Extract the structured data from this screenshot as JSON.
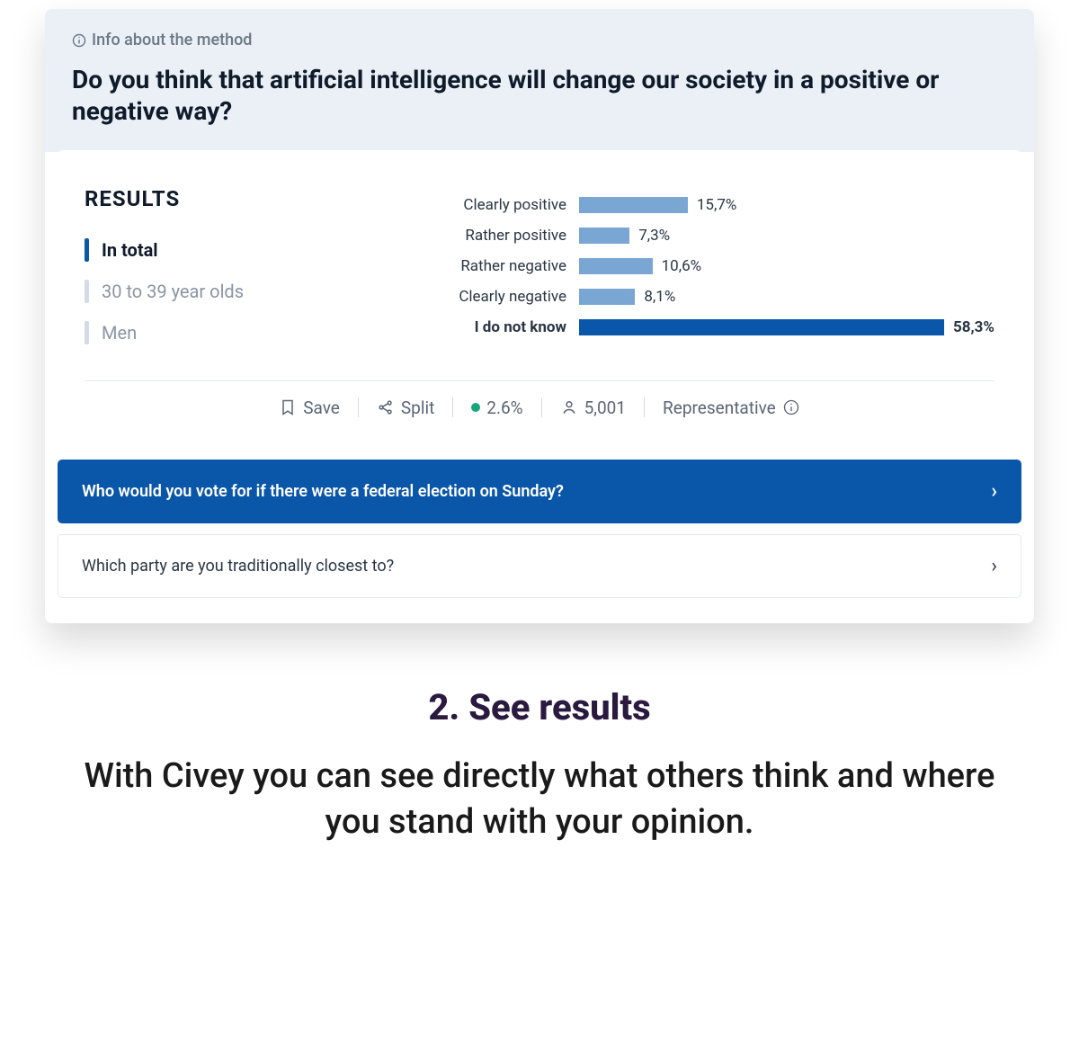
{
  "header": {
    "info_label": "Info about the method",
    "question": "Do you think that artificial intelligence will change our society in a positive or negative way?"
  },
  "results": {
    "title": "RESULTS",
    "filters": [
      {
        "label": "In total",
        "active": true
      },
      {
        "label": "30 to 39 year olds",
        "active": false
      },
      {
        "label": "Men",
        "active": false
      }
    ]
  },
  "chart_data": {
    "type": "bar",
    "categories": [
      "Clearly positive",
      "Rather positive",
      "Rather negative",
      "Clearly negative",
      "I do not know"
    ],
    "values": [
      15.7,
      7.3,
      10.6,
      8.1,
      58.3
    ],
    "value_labels": [
      "15,7%",
      "7,3%",
      "10,6%",
      "8,1%",
      "58,3%"
    ],
    "highlight_index": 4,
    "xlim": [
      0,
      60
    ],
    "title": "",
    "xlabel": "",
    "ylabel": ""
  },
  "toolbar": {
    "save": "Save",
    "split": "Split",
    "percent": "2.6%",
    "count": "5,001",
    "rep": "Representative"
  },
  "followups": [
    {
      "text": "Who would you vote for if there were a federal election on Sunday?",
      "variant": "primary"
    },
    {
      "text": "Which party are you traditionally closest to?",
      "variant": "secondary"
    }
  ],
  "below": {
    "title": "2. See results",
    "text": "With Civey you can see directly what others think and where you stand with your opinion."
  }
}
